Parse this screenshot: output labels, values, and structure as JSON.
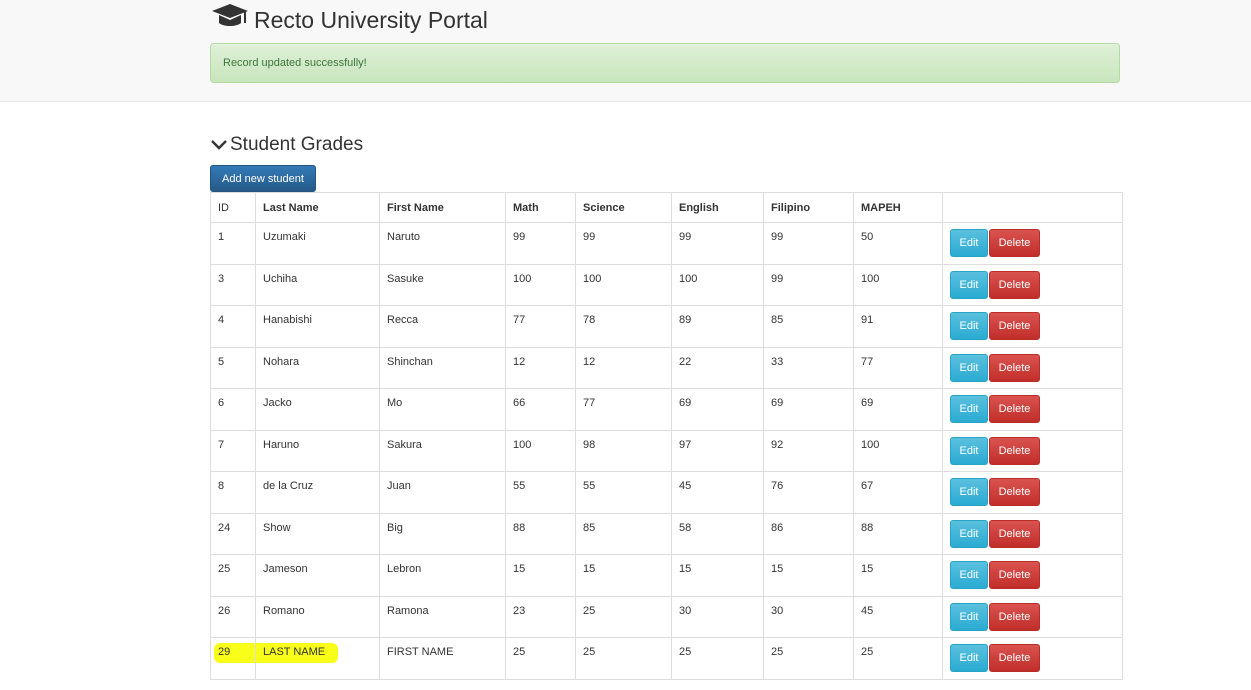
{
  "header": {
    "brand_title": "Recto University Portal",
    "brand_icon": "graduation-cap-icon"
  },
  "alert": {
    "message": "Record updated successfully!",
    "color": "#3c763d"
  },
  "section": {
    "title": "Student Grades",
    "toggle_icon": "chevron-down-icon"
  },
  "add_button": {
    "label": "Add new student",
    "color": "#337ab7"
  },
  "table": {
    "headers": {
      "id": "ID",
      "last_name": "Last Name",
      "first_name": "First Name",
      "math": "Math",
      "science": "Science",
      "english": "English",
      "filipino": "Filipino",
      "mapeh": "MAPEH",
      "actions": ""
    },
    "actions": {
      "edit": "Edit",
      "delete": "Delete"
    },
    "rows": [
      {
        "id": "1",
        "last": "Uzumaki",
        "first": "Naruto",
        "math": "99",
        "science": "99",
        "english": "99",
        "filipino": "99",
        "mapeh": "50"
      },
      {
        "id": "3",
        "last": "Uchiha",
        "first": "Sasuke",
        "math": "100",
        "science": "100",
        "english": "100",
        "filipino": "99",
        "mapeh": "100"
      },
      {
        "id": "4",
        "last": "Hanabishi",
        "first": "Recca",
        "math": "77",
        "science": "78",
        "english": "89",
        "filipino": "85",
        "mapeh": "91"
      },
      {
        "id": "5",
        "last": "Nohara",
        "first": "Shinchan",
        "math": "12",
        "science": "12",
        "english": "22",
        "filipino": "33",
        "mapeh": "77"
      },
      {
        "id": "6",
        "last": "Jacko",
        "first": "Mo",
        "math": "66",
        "science": "77",
        "english": "69",
        "filipino": "69",
        "mapeh": "69"
      },
      {
        "id": "7",
        "last": "Haruno",
        "first": "Sakura",
        "math": "100",
        "science": "98",
        "english": "97",
        "filipino": "92",
        "mapeh": "100"
      },
      {
        "id": "8",
        "last": "de la Cruz",
        "first": "Juan",
        "math": "55",
        "science": "55",
        "english": "45",
        "filipino": "76",
        "mapeh": "67"
      },
      {
        "id": "24",
        "last": "Show",
        "first": "Big",
        "math": "88",
        "science": "85",
        "english": "58",
        "filipino": "86",
        "mapeh": "88"
      },
      {
        "id": "25",
        "last": "Jameson",
        "first": "Lebron",
        "math": "15",
        "science": "15",
        "english": "15",
        "filipino": "15",
        "mapeh": "15"
      },
      {
        "id": "26",
        "last": "Romano",
        "first": "Ramona",
        "math": "23",
        "science": "25",
        "english": "30",
        "filipino": "30",
        "mapeh": "45"
      },
      {
        "id": "29",
        "last": "LAST NAME",
        "first": "FIRST NAME",
        "math": "25",
        "science": "25",
        "english": "25",
        "filipino": "25",
        "mapeh": "25",
        "highlighted": true
      }
    ]
  },
  "colors": {
    "edit_button": "#5bc0de",
    "delete_button": "#d9534f",
    "highlight": "#f7ff00"
  }
}
